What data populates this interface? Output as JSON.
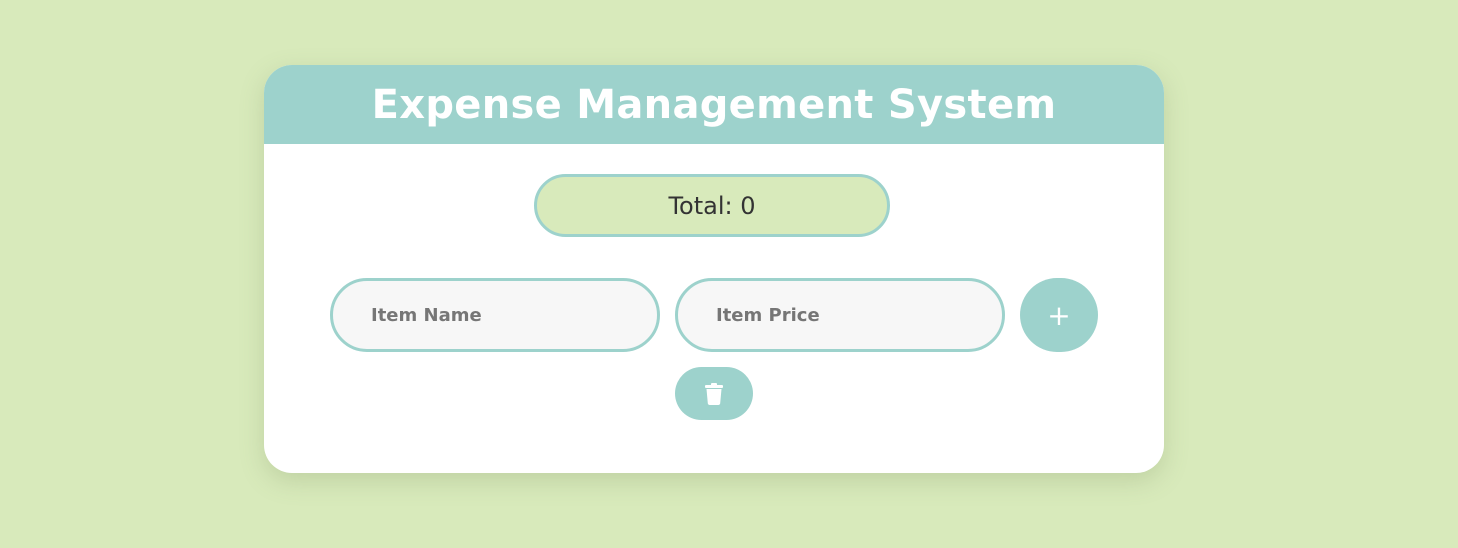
{
  "header": {
    "title": "Expense Management System"
  },
  "summary": {
    "total_label": "Total: 0"
  },
  "form": {
    "item_name_placeholder": "Item Name",
    "item_name_value": "",
    "item_price_placeholder": "Item Price",
    "item_price_value": "",
    "add_button_label": "+",
    "add_button_icon": "plus-icon",
    "clear_button_icon": "trash-icon"
  },
  "colors": {
    "background": "#d8eabb",
    "accent": "#9dd2cc",
    "card": "#ffffff",
    "input_background": "#f7f7f7",
    "total_pill_background": "#d8eabb"
  }
}
